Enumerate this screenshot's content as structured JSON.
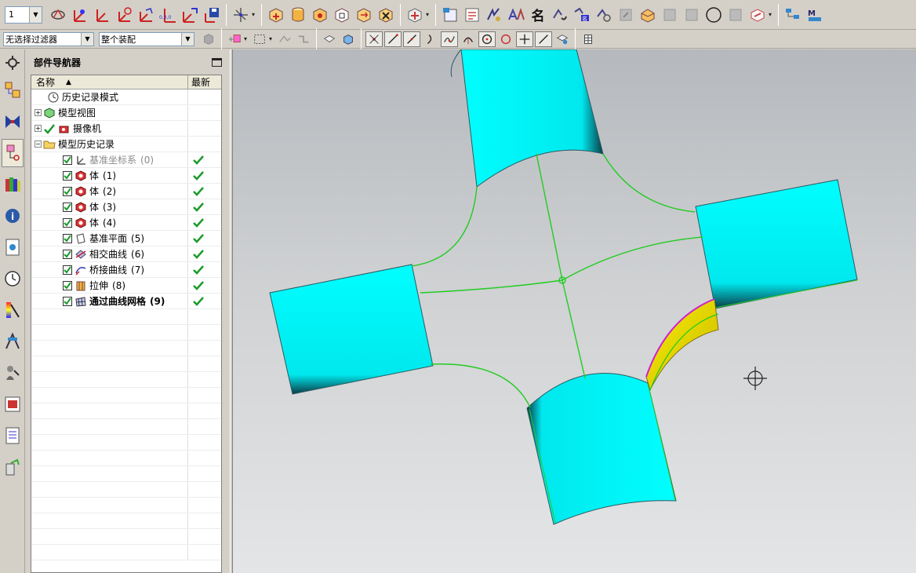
{
  "toolbar_top": {
    "layer_value": "1",
    "name_button_label": "名"
  },
  "toolbar_select": {
    "filter_value": "无选择过滤器",
    "assembly_value": "整个装配"
  },
  "navigator": {
    "title": "部件导航器",
    "col_name": "名称",
    "col_latest": "最新",
    "rows": [
      {
        "label": "历史记录模式",
        "num": "",
        "level": 1
      },
      {
        "label": "模型视图",
        "num": "",
        "level": 0
      },
      {
        "label": "摄像机",
        "num": "",
        "level": 0
      },
      {
        "label": "模型历史记录",
        "num": "",
        "level": 0
      },
      {
        "label": "基准坐标系",
        "num": "(0)",
        "level": 2
      },
      {
        "label": "体",
        "num": "(1)",
        "level": 2
      },
      {
        "label": "体",
        "num": "(2)",
        "level": 2
      },
      {
        "label": "体",
        "num": "(3)",
        "level": 2
      },
      {
        "label": "体",
        "num": "(4)",
        "level": 2
      },
      {
        "label": "基准平面",
        "num": "(5)",
        "level": 2
      },
      {
        "label": "相交曲线",
        "num": "(6)",
        "level": 2
      },
      {
        "label": "桥接曲线",
        "num": "(7)",
        "level": 2
      },
      {
        "label": "拉伸",
        "num": "(8)",
        "level": 2
      },
      {
        "label": "通过曲线网格",
        "num": "(9)",
        "level": 2
      }
    ]
  },
  "colors": {
    "body": "#00f0f0",
    "curve": "#22cc22",
    "surface": "#e6d200",
    "edge_highlight": "#d020d0"
  }
}
